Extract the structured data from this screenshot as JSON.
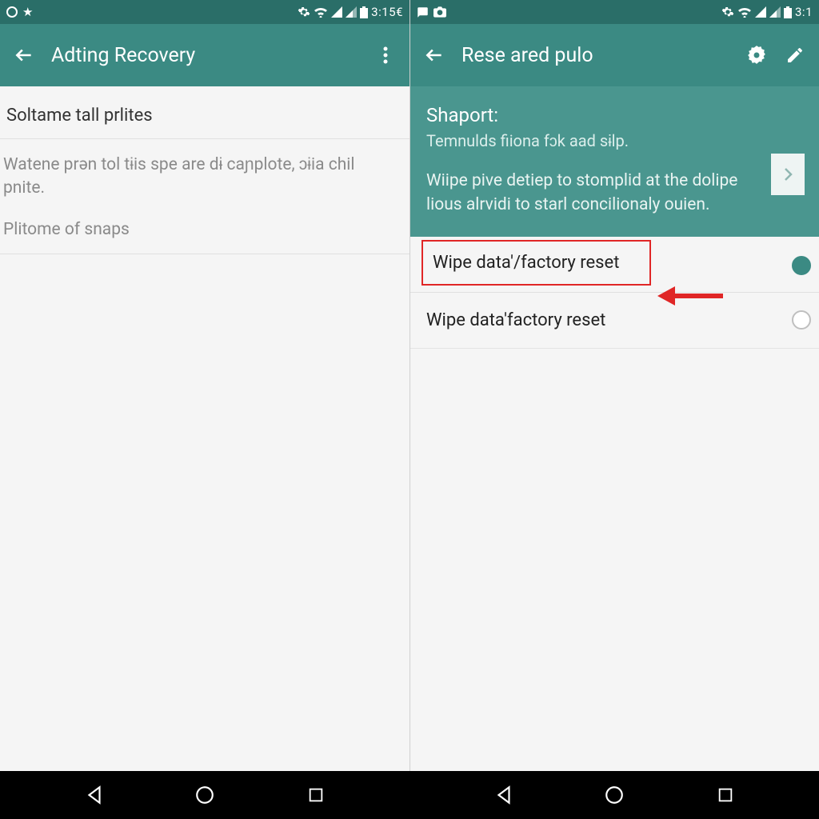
{
  "colors": {
    "teal_dark": "#2a6e68",
    "teal": "#3b8a83",
    "teal_light": "#4a968f",
    "red": "#e02626"
  },
  "status": {
    "left_star": "★",
    "clock_left": "3:15€",
    "clock_right": "3:1"
  },
  "left": {
    "title": "Adting Recovery",
    "section_heading": "Soltame tall prlites",
    "body": "Watene prən tol tɨis spe are dɨ caɲplote, ɔɨia chil pnite.",
    "sub_label": "Plitome of snaps"
  },
  "right": {
    "title": "Rese ared pulo",
    "panel_title": "Shaport:",
    "panel_sub": "Temnulds fiiona fɔk aad sɨlp.",
    "panel_body": "Wiipe pive detiep to stomplid at the dolipe lious alrvidi to starl concilionaly ouien.",
    "rows": [
      {
        "label": "Wipe data'/factory reset",
        "selected": true,
        "highlighted": true
      },
      {
        "label": "Wipe data'factory reset",
        "selected": false,
        "highlighted": false
      }
    ]
  }
}
